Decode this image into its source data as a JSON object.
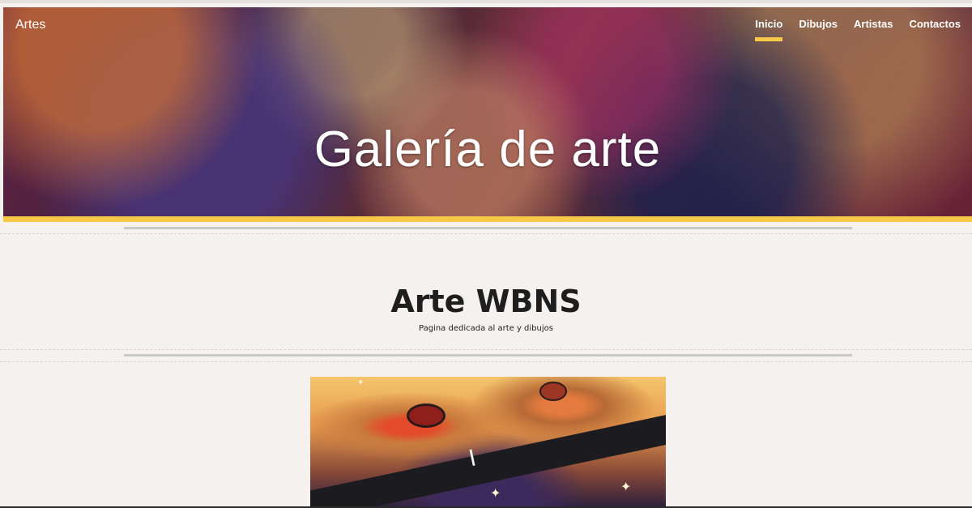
{
  "header": {
    "site_name": "Artes",
    "nav": [
      {
        "label": "Inicio",
        "active": true
      },
      {
        "label": "Dibujos",
        "active": false
      },
      {
        "label": "Artistas",
        "active": false
      },
      {
        "label": "Contactos",
        "active": false
      }
    ],
    "hero_title": "Galería de arte",
    "accent_color": "#f7c948"
  },
  "main": {
    "heading": "Arte WBNS",
    "subtitle": "Pagina dedicada al arte y dibujos",
    "artwork_glyph": "I"
  }
}
